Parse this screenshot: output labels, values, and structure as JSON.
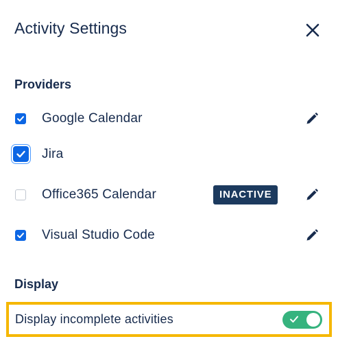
{
  "header": {
    "title": "Activity Settings",
    "close_icon": "close-icon"
  },
  "providers": {
    "heading": "Providers",
    "items": [
      {
        "label": "Google Calendar",
        "checked": true,
        "editable": true,
        "badge": ""
      },
      {
        "label": "Jira",
        "checked": true,
        "editable": false,
        "badge": ""
      },
      {
        "label": "Office365 Calendar",
        "checked": false,
        "editable": true,
        "badge": "INACTIVE"
      },
      {
        "label": "Visual Studio Code",
        "checked": true,
        "editable": true,
        "badge": ""
      }
    ]
  },
  "display": {
    "heading": "Display",
    "incomplete_label": "Display incomplete activities",
    "incomplete_enabled": true
  },
  "colors": {
    "text": "#172b4d",
    "checkbox_checked": "#0c66e4",
    "badge_bg": "#1c3a5e",
    "toggle_on": "#36b37e",
    "highlight": "#f5b700"
  }
}
